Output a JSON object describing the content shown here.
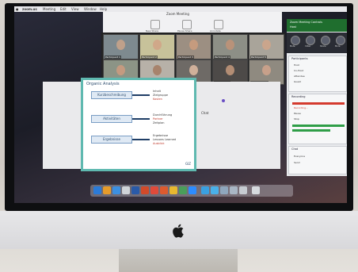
{
  "menubar": {
    "app": "zoom.us",
    "items": [
      "Meeting",
      "Edit",
      "View",
      "Window",
      "Help"
    ]
  },
  "zoom": {
    "window_title": "Zoom Meeting",
    "toolbar": [
      {
        "label": "New Share",
        "icon": "share-icon"
      },
      {
        "label": "Pause Share",
        "icon": "pause-icon"
      },
      {
        "label": "Annotate",
        "icon": "pencil-icon"
      }
    ]
  },
  "participants": [
    "Participant 1",
    "Participant 2",
    "Participant 3",
    "Participant 4",
    "Participant 5",
    "Participant 6",
    "Participant 7",
    "Participant 8",
    "Participant 9",
    "Participant 10"
  ],
  "slide": {
    "title": "Organic Analysis",
    "rows": [
      {
        "label": "Kurzbeschreibung",
        "text": [
          "Inhalt",
          "Zielgruppe",
          "Kosten"
        ]
      },
      {
        "label": "Aktivitäten",
        "text": [
          "Durchführung",
          "Partner",
          "Zeitplan"
        ]
      },
      {
        "label": "Ergebnisse",
        "text": [
          "Ergebnisse",
          "Lessons Learned",
          "Ausblick"
        ]
      }
    ],
    "footer": "GIZ"
  },
  "chat_label": "Chat",
  "panel": {
    "header": "Zoom Meeting Controls",
    "header_sub": "Host",
    "controls": [
      "Mute",
      "Video",
      "Share",
      "More"
    ],
    "sections": [
      {
        "title": "Participants",
        "items": [
          "Host",
          "Co-Host",
          "Attendee",
          "Guest"
        ]
      },
      {
        "title": "Recording",
        "items": [
          "Recording...",
          "Pause",
          "Stop"
        ]
      },
      {
        "title": "Chat",
        "items": [
          "Everyone",
          "Send"
        ]
      }
    ]
  },
  "colors": {
    "accent_green": "#1f6e2e",
    "record_red": "#d43a2e",
    "slide_teal": "#5fb9b0"
  }
}
